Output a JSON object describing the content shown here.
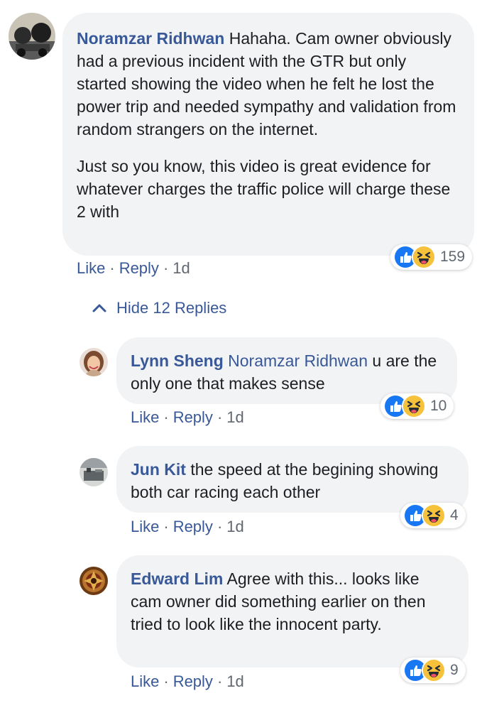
{
  "thread": {
    "main_comment": {
      "author": "Noramzar Ridhwan",
      "paragraph1": "Hahaha. Cam owner obviously had a previous incident with the GTR but only started showing the video when he felt he lost the power trip and needed sympathy and validation from random strangers on the internet.",
      "paragraph2": "Just so you know, this video is great evidence for whatever charges the traffic police will charge these 2 with",
      "reaction_count": "159",
      "like_label": "Like",
      "reply_label": "Reply",
      "separator": "·",
      "time": "1d"
    },
    "hide_replies_label": "Hide 12 Replies",
    "replies": [
      {
        "author": "Lynn Sheng",
        "mention": "Noramzar Ridhwan",
        "text": " u are the only one that makes sense",
        "reaction_count": "10",
        "like_label": "Like",
        "reply_label": "Reply",
        "separator": "·",
        "time": "1d"
      },
      {
        "author": "Jun Kit",
        "text": "the speed at the begining showing both car racing each other",
        "reaction_count": "4",
        "like_label": "Like",
        "reply_label": "Reply",
        "separator": "·",
        "time": "1d"
      },
      {
        "author": "Edward Lim",
        "text": "Agree with this... looks like cam owner did something earlier on then tried to look like the innocent party.",
        "reaction_count": "9",
        "like_label": "Like",
        "reply_label": "Reply",
        "separator": "·",
        "time": "1d"
      }
    ]
  },
  "icons": {
    "like": "like-icon",
    "haha": "haha-icon",
    "chevron": "chevron-up-icon"
  },
  "colors": {
    "link": "#385898",
    "bubble": "#f2f3f5",
    "meta": "#606770",
    "like_blue": "#1877f2",
    "haha_yellow": "#f7c23b"
  }
}
